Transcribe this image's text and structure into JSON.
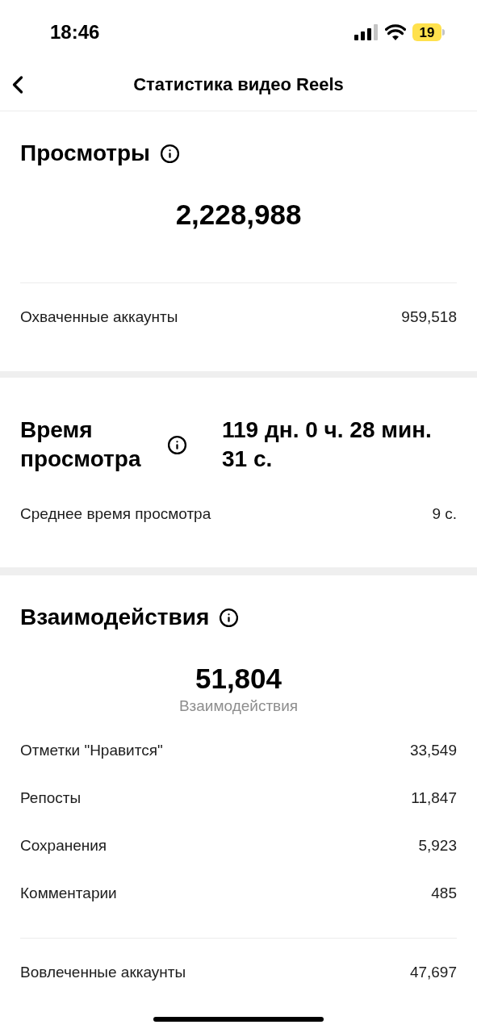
{
  "status_bar": {
    "time": "18:46",
    "battery": "19"
  },
  "header": {
    "title": "Статистика видео Reels"
  },
  "sections": [
    {
      "kind": "total",
      "title": "Просмотры",
      "info": true,
      "value": "2,228,988",
      "footer": {
        "label": "Охваченные аккаунты",
        "value": "959,518"
      }
    },
    {
      "kind": "split",
      "title": "Время просмотра",
      "info": true,
      "value": "119 дн. 0 ч. 28 мин. 31 с.",
      "rows": [
        {
          "label": "Среднее время просмотра",
          "value": "9 с."
        }
      ]
    },
    {
      "kind": "total",
      "title": "Взаимодействия",
      "info": true,
      "value": "51,804",
      "caption": "Взаимодействия",
      "rows": [
        {
          "label": "Отметки \"Нравится\"",
          "value": "33,549"
        },
        {
          "label": "Репосты",
          "value": "11,847"
        },
        {
          "label": "Сохранения",
          "value": "5,923"
        },
        {
          "label": "Комментарии",
          "value": "485"
        }
      ],
      "footer": {
        "label": "Вовлеченные аккаунты",
        "value": "47,697"
      }
    }
  ]
}
